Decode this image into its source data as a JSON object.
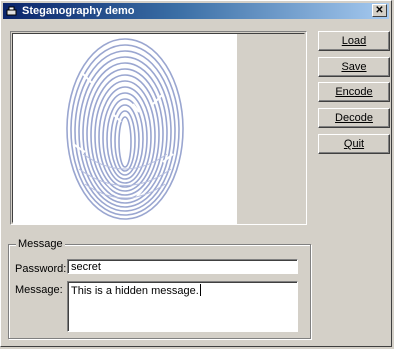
{
  "window": {
    "title": "Steganography demo",
    "close_label": "✕"
  },
  "buttons": {
    "load": "Load",
    "save": "Save",
    "encode": "Encode",
    "decode": "Decode",
    "quit": "Quit"
  },
  "message_group": {
    "label": "Message",
    "password_label": "Password:",
    "password_value": "secret",
    "message_label": "Message:",
    "message_value": "This is a hidden message."
  },
  "image": {
    "icon": "fingerprint-image",
    "color": "#9aa6d0"
  }
}
